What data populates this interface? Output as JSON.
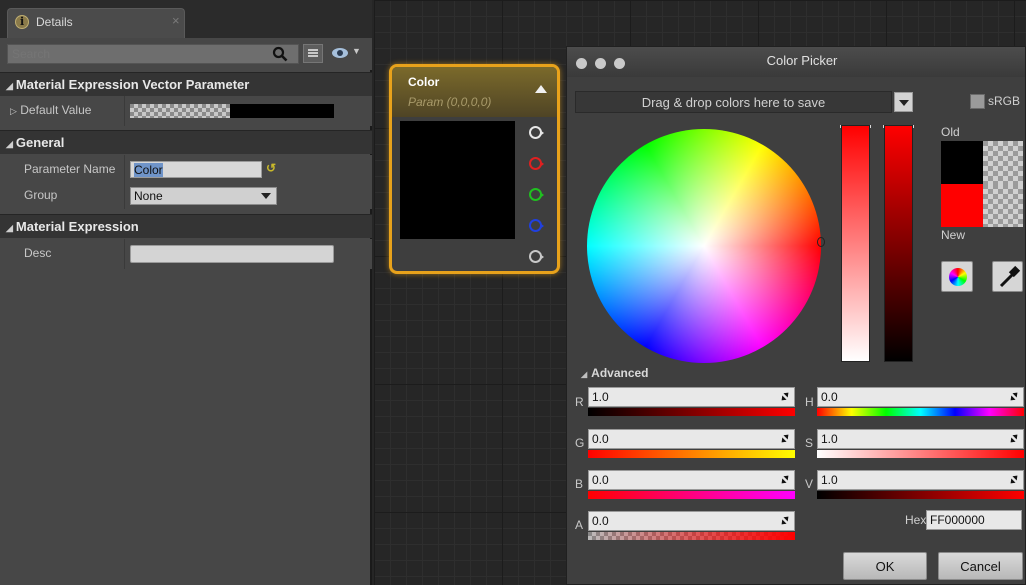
{
  "details_panel": {
    "tab_label": "Details",
    "tab_close": "×",
    "search_placeholder": "Search",
    "sections": {
      "vector_param": {
        "title": "Material Expression Vector Parameter",
        "default_value_label": "Default Value"
      },
      "general": {
        "title": "General",
        "param_name_label": "Parameter Name",
        "param_name_value": "Color",
        "group_label": "Group",
        "group_value": "None"
      },
      "material_expression": {
        "title": "Material Expression",
        "desc_label": "Desc",
        "desc_value": ""
      }
    }
  },
  "node": {
    "title": "Color",
    "subtitle": "Param (0,0,0,0)",
    "pins": [
      {
        "name": "rgb",
        "color": "#e6e6e6"
      },
      {
        "name": "r",
        "color": "#e02020"
      },
      {
        "name": "g",
        "color": "#20c020"
      },
      {
        "name": "b",
        "color": "#2040e0"
      },
      {
        "name": "a",
        "color": "#c8c8c8"
      }
    ]
  },
  "color_picker": {
    "title": "Color Picker",
    "drop_bar_text": "Drag & drop colors here to save",
    "srgb_label": "sRGB",
    "old_label": "Old",
    "new_label": "New",
    "old_color": "#000000",
    "new_color": "#ff0000",
    "advanced_label": "Advanced",
    "channels": {
      "r": {
        "label": "R",
        "value": "1.0"
      },
      "g": {
        "label": "G",
        "value": "0.0"
      },
      "b": {
        "label": "B",
        "value": "0.0"
      },
      "a": {
        "label": "A",
        "value": "0.0"
      },
      "h": {
        "label": "H",
        "value": "0.0"
      },
      "s": {
        "label": "S",
        "value": "1.0"
      },
      "v": {
        "label": "V",
        "value": "1.0"
      }
    },
    "hex_label": "Hex",
    "hex_value": "FF000000",
    "ok_label": "OK",
    "cancel_label": "Cancel"
  }
}
